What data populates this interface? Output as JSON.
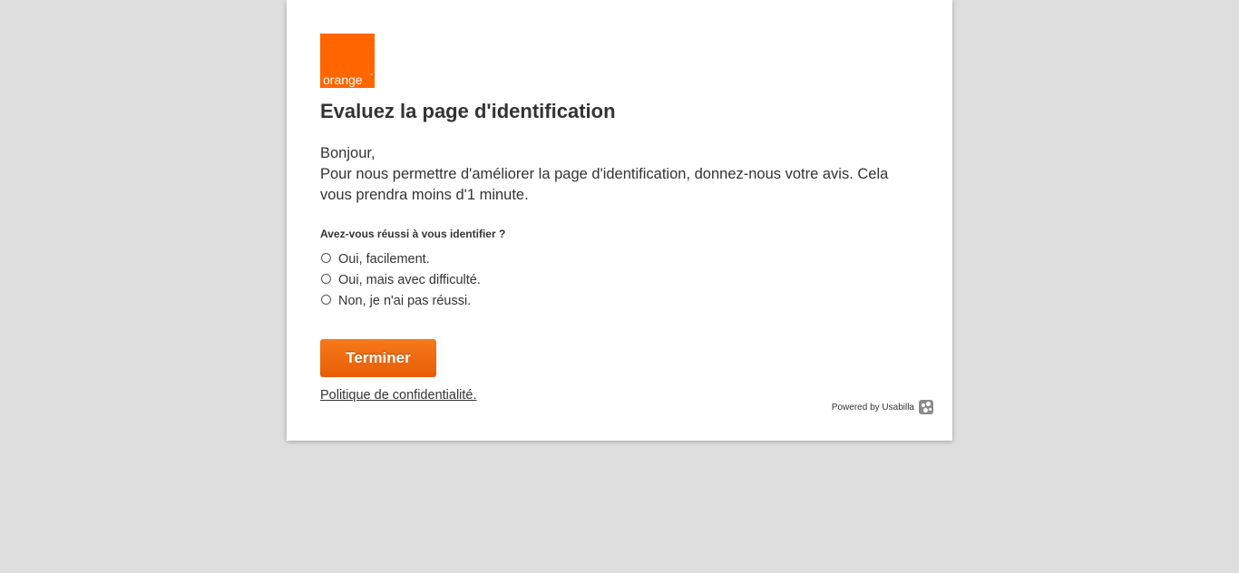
{
  "brand": {
    "logo_text": "orange",
    "logo_tm": "™",
    "color": "#ff6600"
  },
  "survey": {
    "title": "Evaluez la page d'identification",
    "greeting": "Bonjour,",
    "intro": "Pour nous permettre d'améliorer la page d'identification, donnez-nous votre avis. Cela vous prendra moins d'1 minute.",
    "question": "Avez-vous réussi à vous identifier ?",
    "options": [
      {
        "label": "Oui, facilement.",
        "selected": false
      },
      {
        "label": "Oui, mais avec difficulté.",
        "selected": false
      },
      {
        "label": "Non, je n'ai pas réussi.",
        "selected": false
      }
    ],
    "submit_label": "Terminer",
    "privacy_label": "Politique de confidentialité."
  },
  "footer": {
    "powered_by": "Powered by Usabilla",
    "icon": "usabilla-icon"
  }
}
